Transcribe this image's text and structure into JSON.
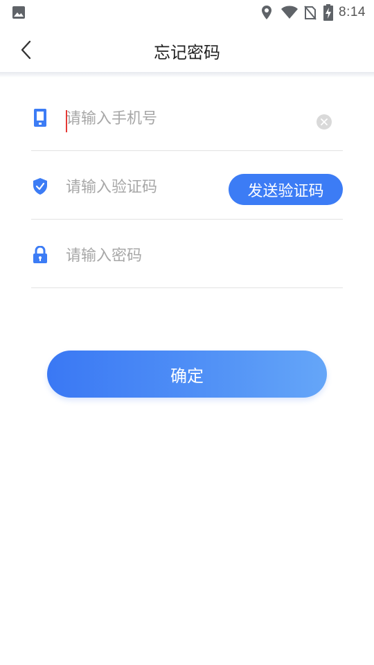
{
  "status_bar": {
    "time": "8:14",
    "icons": [
      "image-icon",
      "location-icon",
      "wifi-icon",
      "no-sim-icon",
      "battery-charging-icon"
    ]
  },
  "nav": {
    "title": "忘记密码",
    "back_icon": "chevron-left-icon"
  },
  "form": {
    "phone": {
      "value": "",
      "placeholder": "请输入手机号",
      "icon": "phone-icon",
      "clear_icon": "clear-icon"
    },
    "code": {
      "value": "",
      "placeholder": "请输入验证码",
      "icon": "shield-check-icon",
      "send_label": "发送验证码"
    },
    "password": {
      "value": "",
      "placeholder": "请输入密码",
      "icon": "lock-icon"
    }
  },
  "confirm_label": "确定",
  "colors": {
    "accent": "#3c7cf5",
    "button_gradient_start": "#3a78f4",
    "button_gradient_end": "#65a6f8",
    "caret": "#e53935"
  }
}
